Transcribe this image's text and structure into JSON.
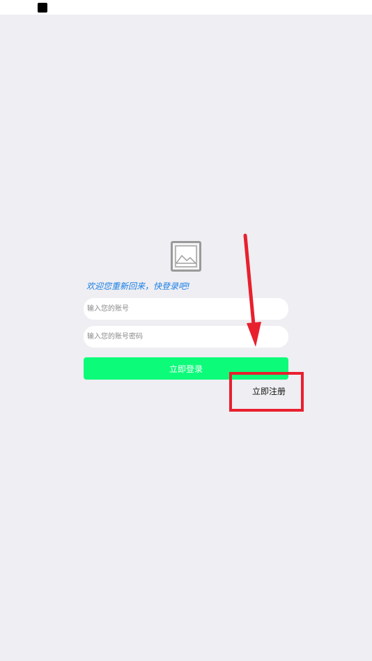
{
  "status_bar": {
    "indicator_icon": "black-square-icon"
  },
  "logo": {
    "icon": "image-placeholder-icon"
  },
  "welcome_text": "欢迎您重新回来，快登录吧!",
  "account_field": {
    "value": "",
    "placeholder": "输入您的账号"
  },
  "password_field": {
    "value": "",
    "placeholder": "输入您的账号密码"
  },
  "login_button": {
    "label": "立即登录",
    "color": "#0cfc7a"
  },
  "register_link": {
    "label": "立即注册"
  },
  "annotation": {
    "color": "#e8202e",
    "arrow_icon": "red-arrow-icon"
  }
}
